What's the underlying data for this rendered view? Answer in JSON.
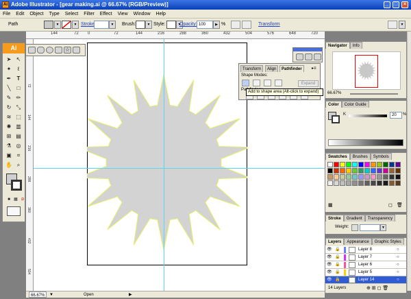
{
  "window": {
    "title": "Adobe Illustrator - [gear making.ai @ 66.67% (RGB/Preview)]",
    "app_badge": "Ai"
  },
  "menu": [
    "File",
    "Edit",
    "Object",
    "Type",
    "Select",
    "Filter",
    "Effect",
    "View",
    "Window",
    "Help"
  ],
  "control_bar": {
    "selection_label": "Path",
    "stroke_label": "Stroke:",
    "brush_label": "Brush:",
    "style_label": "Style:",
    "opacity_label": "Opacity:",
    "opacity_value": "100",
    "opacity_unit": "%",
    "transform_label": "Transform"
  },
  "rulers": {
    "h_ticks": [
      "144",
      "72",
      "0",
      "72",
      "144",
      "216",
      "288",
      "360",
      "432",
      "504",
      "576",
      "648",
      "720"
    ],
    "v_ticks": [
      "0",
      "72",
      "144",
      "216",
      "288",
      "360",
      "432",
      "504"
    ]
  },
  "pathfinder": {
    "tabs": [
      "Transform",
      "Align",
      "Pathfinder"
    ],
    "shape_modes_label": "Shape Modes:",
    "pathfinders_label": "Pathfinders:",
    "expand_label": "Expand",
    "tooltip": "Add to shape area (Alt-click to expand)"
  },
  "navigator": {
    "tabs": [
      "Navigator",
      "Info"
    ],
    "zoom": "66.67%"
  },
  "color_panel": {
    "tabs": [
      "Color",
      "Color Guide"
    ],
    "value": "20",
    "unit": "%"
  },
  "swatches_panel": {
    "tabs": [
      "Swatches",
      "Brushes",
      "Symbols"
    ],
    "colors": [
      "#ffffff",
      "#ff0000",
      "#ffff00",
      "#00ff00",
      "#00ffff",
      "#0000ff",
      "#ff00ff",
      "#ff9900",
      "#99cc00",
      "#006600",
      "#003399",
      "#660099",
      "#000000",
      "#cc3300",
      "#ff6600",
      "#ffcc00",
      "#66cc33",
      "#339966",
      "#00cccc",
      "#3366ff",
      "#6633cc",
      "#cc0099",
      "#996633",
      "#663300",
      "#cc9966",
      "#ffcc99",
      "#cccc99",
      "#99cc99",
      "#66cccc",
      "#9999ff",
      "#cc99cc",
      "#ff99cc",
      "#999999",
      "#666666",
      "#333333",
      "#111111",
      "#f0f0f0",
      "#d8d8d8",
      "#c0c0c0",
      "#a8a8a8",
      "#909090",
      "#787878",
      "#606060",
      "#484848",
      "#303030",
      "#181818",
      "#8b5a2b",
      "#5a3a1a"
    ]
  },
  "stroke_panel": {
    "tabs": [
      "Stroke",
      "Gradient",
      "Transparency"
    ],
    "weight_label": "Weight:"
  },
  "layers_panel": {
    "tabs": [
      "Layers",
      "Appearance",
      "Graphic Styles"
    ],
    "rows": [
      {
        "name": "Layer 8",
        "color": "#6b7cff"
      },
      {
        "name": "Layer 7",
        "color": "#e02bff"
      },
      {
        "name": "Layer 6",
        "color": "#ff4fa0"
      },
      {
        "name": "Layer 5",
        "color": "#ffd000"
      },
      {
        "name": "Layer 14",
        "color": "#2f5bd5"
      }
    ],
    "count_label": "14 Layers"
  },
  "status": {
    "zoom": "66.67%",
    "state": "Open"
  }
}
